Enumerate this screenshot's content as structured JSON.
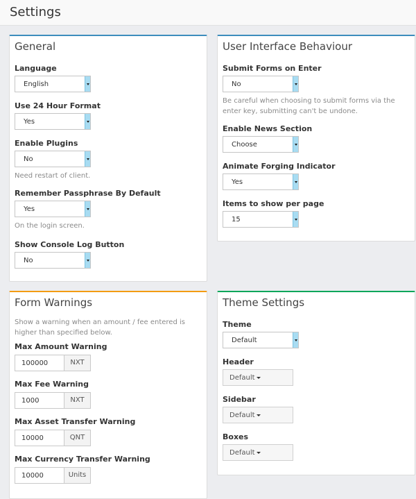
{
  "page_title": "Settings",
  "general": {
    "title": "General",
    "language_label": "Language",
    "language_value": "English",
    "hour24_label": "Use 24 Hour Format",
    "hour24_value": "Yes",
    "plugins_label": "Enable Plugins",
    "plugins_value": "No",
    "plugins_help": "Need restart of client.",
    "remember_label": "Remember Passphrase By Default",
    "remember_value": "Yes",
    "remember_help": "On the login screen.",
    "console_label": "Show Console Log Button",
    "console_value": "No"
  },
  "ui": {
    "title": "User Interface Behaviour",
    "submit_label": "Submit Forms on Enter",
    "submit_value": "No",
    "submit_help_1": "Be careful when choosing to submit forms via the",
    "submit_help_2": "enter key, submitting can't be undone.",
    "news_label": "Enable News Section",
    "news_value": "Choose",
    "forging_label": "Animate Forging Indicator",
    "forging_value": "Yes",
    "items_label": "Items to show per page",
    "items_value": "15"
  },
  "warnings": {
    "title": "Form Warnings",
    "help_1": "Show a warning when an amount / fee entered is",
    "help_2": "higher than specified below.",
    "amount_label": "Max Amount Warning",
    "amount_value": "100000",
    "amount_unit": "NXT",
    "fee_label": "Max Fee Warning",
    "fee_value": "1000",
    "fee_unit": "NXT",
    "asset_label": "Max Asset Transfer Warning",
    "asset_value": "10000",
    "asset_unit": "QNT",
    "currency_label": "Max Currency Transfer Warning",
    "currency_value": "10000",
    "currency_unit": "Units"
  },
  "theme": {
    "title": "Theme Settings",
    "theme_label": "Theme",
    "theme_value": "Default",
    "header_label": "Header",
    "header_value": "Default",
    "sidebar_label": "Sidebar",
    "sidebar_value": "Default",
    "boxes_label": "Boxes",
    "boxes_value": "Default"
  },
  "colors": {
    "general_top": "#3c8dbc",
    "ui_top": "#3c8dbc",
    "warnings_top": "#f39c12",
    "theme_top": "#00a65a"
  }
}
